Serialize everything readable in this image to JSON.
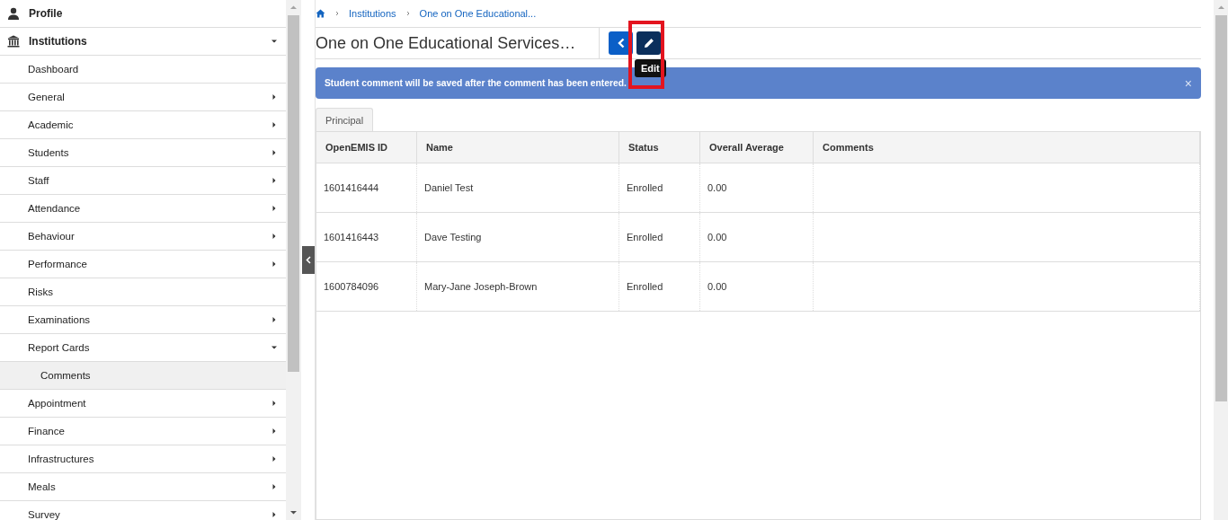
{
  "sidebar": {
    "top_items": [
      {
        "label": "Profile",
        "kind": "profile"
      },
      {
        "label": "Institutions",
        "kind": "institution",
        "expanded": true,
        "children": [
          {
            "label": "Dashboard",
            "kind": "link",
            "selected": false
          },
          {
            "label": "General",
            "kind": "group",
            "expanded": false,
            "selected": false
          },
          {
            "label": "Academic",
            "kind": "group",
            "expanded": false,
            "selected": false
          },
          {
            "label": "Students",
            "kind": "group",
            "expanded": false,
            "selected": false
          },
          {
            "label": "Staff",
            "kind": "group",
            "expanded": false,
            "selected": false
          },
          {
            "label": "Attendance",
            "kind": "group",
            "expanded": false,
            "selected": false
          },
          {
            "label": "Behaviour",
            "kind": "group",
            "expanded": false,
            "selected": false
          },
          {
            "label": "Performance",
            "kind": "group",
            "expanded": false,
            "selected": false
          },
          {
            "label": "Risks",
            "kind": "link",
            "selected": false
          },
          {
            "label": "Examinations",
            "kind": "group",
            "expanded": false,
            "selected": false
          },
          {
            "label": "Report Cards",
            "kind": "group",
            "expanded": true,
            "selected": false,
            "children": [
              {
                "label": "Comments",
                "kind": "link",
                "selected": true
              }
            ]
          },
          {
            "label": "Appointment",
            "kind": "group",
            "expanded": false,
            "selected": false
          },
          {
            "label": "Finance",
            "kind": "group",
            "expanded": false,
            "selected": false
          },
          {
            "label": "Infrastructures",
            "kind": "group",
            "expanded": false,
            "selected": false
          },
          {
            "label": "Meals",
            "kind": "group",
            "expanded": false,
            "selected": false
          },
          {
            "label": "Survey",
            "kind": "group",
            "expanded": false,
            "selected": false
          }
        ]
      }
    ]
  },
  "breadcrumb": [
    "Institutions",
    "One on One Educational..."
  ],
  "page_title": "One on One Educational Services…",
  "toolbar": {
    "edit_tooltip": "Edit"
  },
  "alert": {
    "message": "Student comment will be saved after the comment has been entered.",
    "close": "×"
  },
  "tabs": [
    {
      "label": "Principal",
      "selected": true
    }
  ],
  "table": {
    "columns": [
      "OpenEMIS ID",
      "Name",
      "Status",
      "Overall Average",
      "Comments"
    ],
    "rows": [
      [
        "1601416444",
        "Daniel Test",
        "Enrolled",
        "0.00",
        ""
      ],
      [
        "1601416443",
        "Dave Testing",
        "Enrolled",
        "0.00",
        ""
      ],
      [
        "1600784096",
        "Mary-Jane Joseph-Brown",
        "Enrolled",
        "0.00",
        ""
      ]
    ]
  }
}
